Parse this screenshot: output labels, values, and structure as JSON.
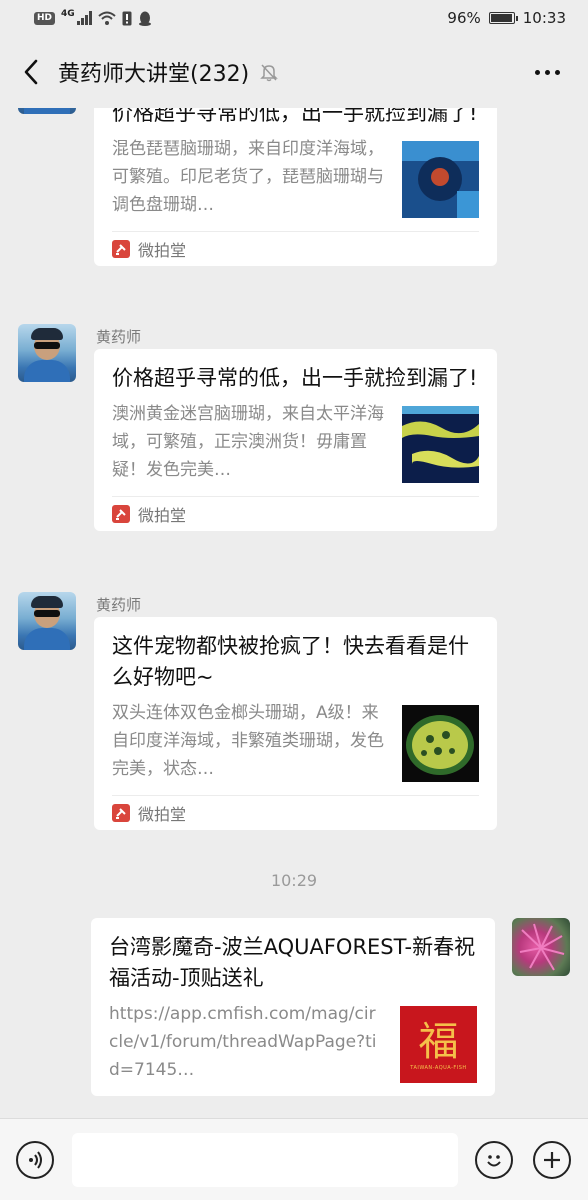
{
  "status_bar": {
    "hd": "HD",
    "network": "4G",
    "battery": "96%",
    "battery_level": 0.96,
    "time": "10:33"
  },
  "header": {
    "title": "黄药师大讲堂(232)"
  },
  "messages": [
    {
      "card_title": "价格超乎寻常的低，出一手就捡到漏了!",
      "card_desc": "混色琵琶脑珊瑚，来自印度洋海域，可繁殖。印尼老货了，琵琶脑珊瑚与调色盘珊瑚…",
      "source": "微拍堂"
    },
    {
      "sender": "黄药师",
      "card_title": "价格超乎寻常的低，出一手就捡到漏了!",
      "card_desc": "澳洲黄金迷宫脑珊瑚，来自太平洋海域，可繁殖，正宗澳洲货！毋庸置疑！发色完美…",
      "source": "微拍堂"
    },
    {
      "sender": "黄药师",
      "card_title": "这件宠物都快被抢疯了！快去看看是什么好物吧~",
      "card_desc": "双头连体双色金榔头珊瑚，A级！来自印度洋海域，非繁殖类珊瑚，发色完美，状态…",
      "source": "微拍堂"
    }
  ],
  "timestamp": "10:29",
  "my_message": {
    "card_title": "台湾影魔奇-波兰AQUAFOREST-新春祝福活动-顶贴送礼",
    "card_desc": "https://app.cmfish.com/mag/circle/v1/forum/threadWapPage?tid=7145…",
    "thumb_char": "福",
    "thumb_caption": "TAIWAN-AQUA-FISH"
  },
  "input": {
    "value": "",
    "placeholder": ""
  }
}
